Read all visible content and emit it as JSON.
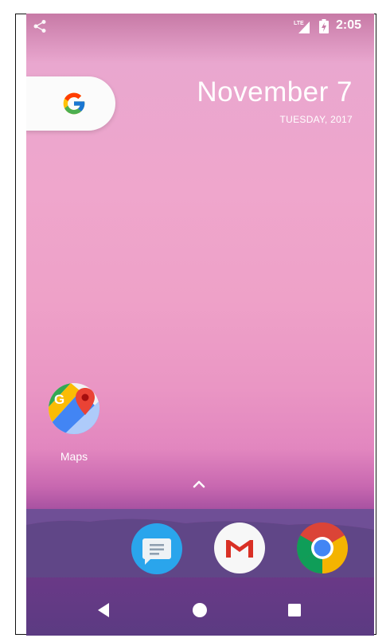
{
  "statusbar": {
    "time": "2:05",
    "network_label": "LTE",
    "icons": [
      "share-icon",
      "lte-signal-icon",
      "battery-charging-icon"
    ]
  },
  "search": {
    "logo_text": "G",
    "icon": "google-g-icon"
  },
  "date_widget": {
    "date": "November 7",
    "day_year": "TUESDAY, 2017"
  },
  "home_apps": [
    {
      "label": "Maps",
      "icon": "google-maps-icon"
    }
  ],
  "dock": {
    "apps": [
      {
        "icon": "messages-icon"
      },
      {
        "icon": "gmail-icon"
      },
      {
        "icon": "chrome-icon"
      }
    ],
    "drawer_icon": "chevron-up-icon"
  },
  "navbar": {
    "buttons": [
      "back-icon",
      "home-icon",
      "recents-icon"
    ]
  },
  "colors": {
    "wallpaper_top": "#e9a7cf",
    "wallpaper_bottom": "#5b3b82",
    "messages_blue": "#2aa5ec",
    "gmail_red": "#d93025",
    "chrome_red": "#db4437",
    "chrome_yellow": "#f4b400",
    "chrome_green": "#0f9d58",
    "chrome_blue": "#4285f4"
  }
}
